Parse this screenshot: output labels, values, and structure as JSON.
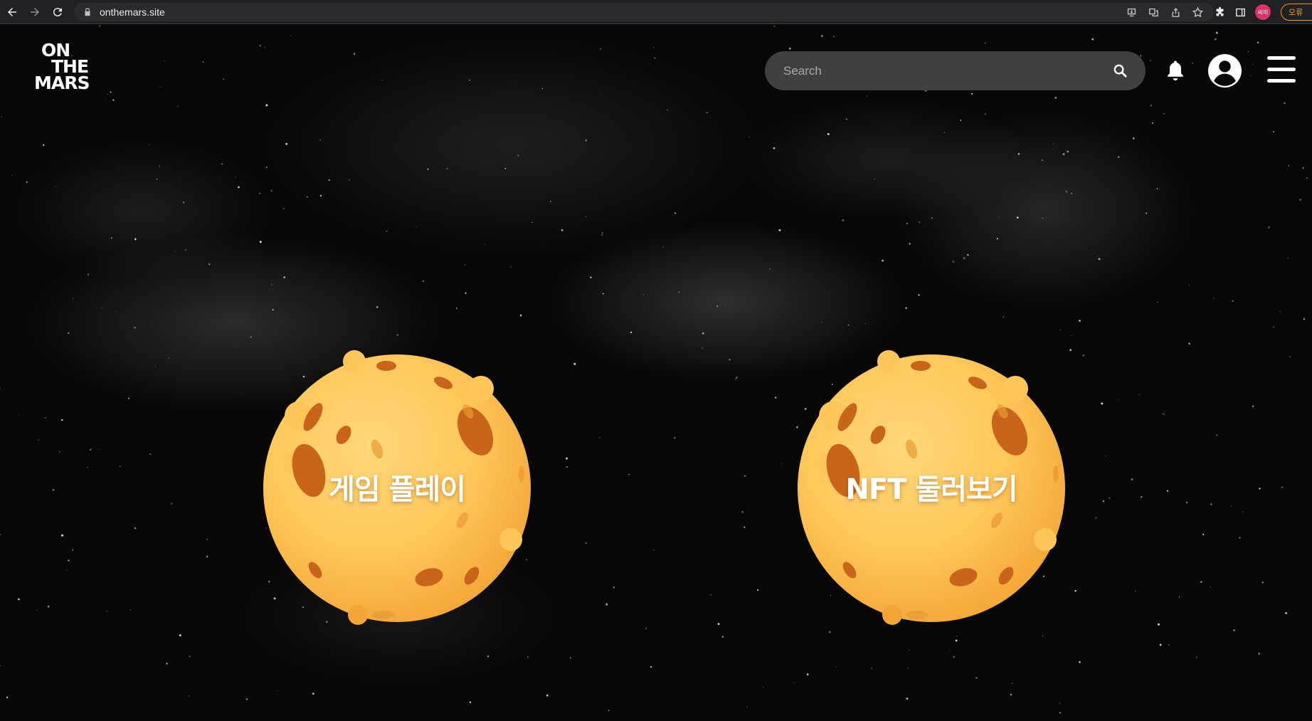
{
  "browser": {
    "url": "onthemars.site",
    "profile_label": "싸피",
    "status_chip": "오류"
  },
  "header": {
    "logo_lines": [
      "ON",
      "THE",
      "MARS"
    ],
    "search_placeholder": "Search"
  },
  "main": {
    "buttons": [
      {
        "label": "게임 플레이"
      },
      {
        "label": "NFT 둘러보기"
      }
    ]
  },
  "colors": {
    "planet_light": "#ffc75a",
    "planet_dark": "#f3a535",
    "crater": "#c8651b",
    "search_bg": "#3f4042",
    "background": "#070707"
  }
}
